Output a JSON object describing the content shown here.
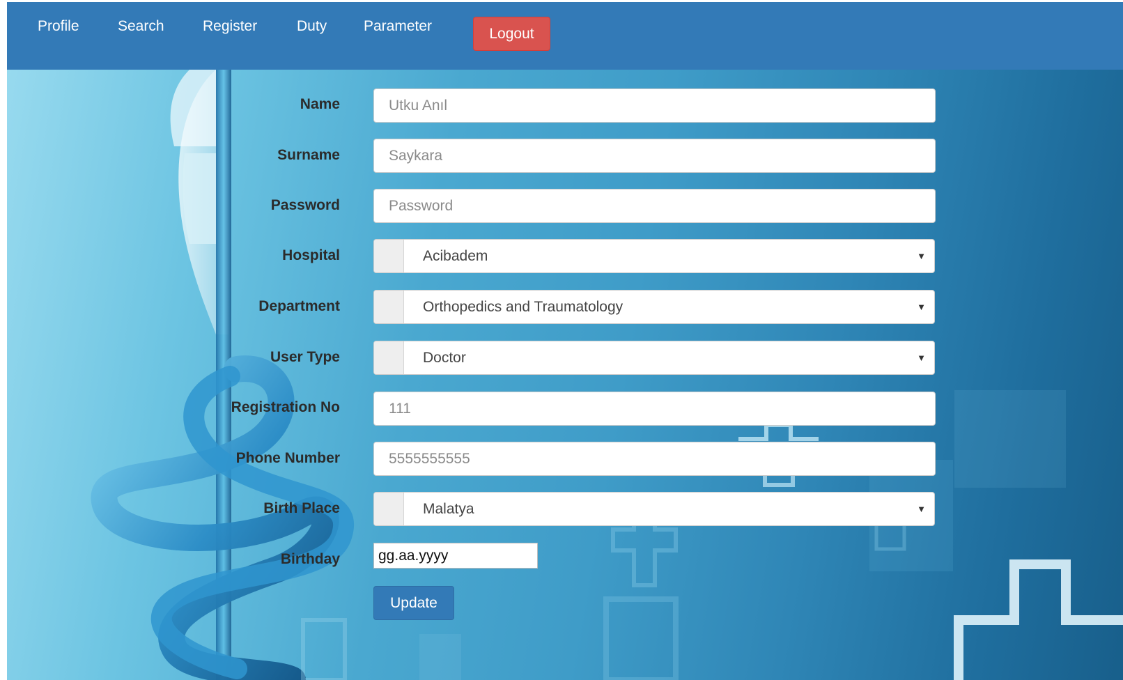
{
  "nav": {
    "items": [
      {
        "label": "Profile"
      },
      {
        "label": "Search"
      },
      {
        "label": "Register"
      },
      {
        "label": "Duty"
      },
      {
        "label": "Parameter"
      }
    ],
    "logout_label": "Logout"
  },
  "form": {
    "name": {
      "label": "Name",
      "placeholder": "Utku Anıl"
    },
    "surname": {
      "label": "Surname",
      "placeholder": "Saykara"
    },
    "password": {
      "label": "Password",
      "placeholder": "Password"
    },
    "hospital": {
      "label": "Hospital",
      "value": "Acibadem"
    },
    "department": {
      "label": "Department",
      "value": "Orthopedics and Traumatology"
    },
    "user_type": {
      "label": "User Type",
      "value": "Doctor"
    },
    "registration_no": {
      "label": "Registration No",
      "placeholder": "111"
    },
    "phone_number": {
      "label": "Phone Number",
      "placeholder": "5555555555"
    },
    "birth_place": {
      "label": "Birth Place",
      "value": "Malatya"
    },
    "birthday": {
      "label": "Birthday",
      "placeholder": "gg.aa.yyyy"
    },
    "update_label": "Update"
  },
  "colors": {
    "navbar": "#337ab7",
    "logout": "#d9534f",
    "primary_button": "#337ab7"
  }
}
